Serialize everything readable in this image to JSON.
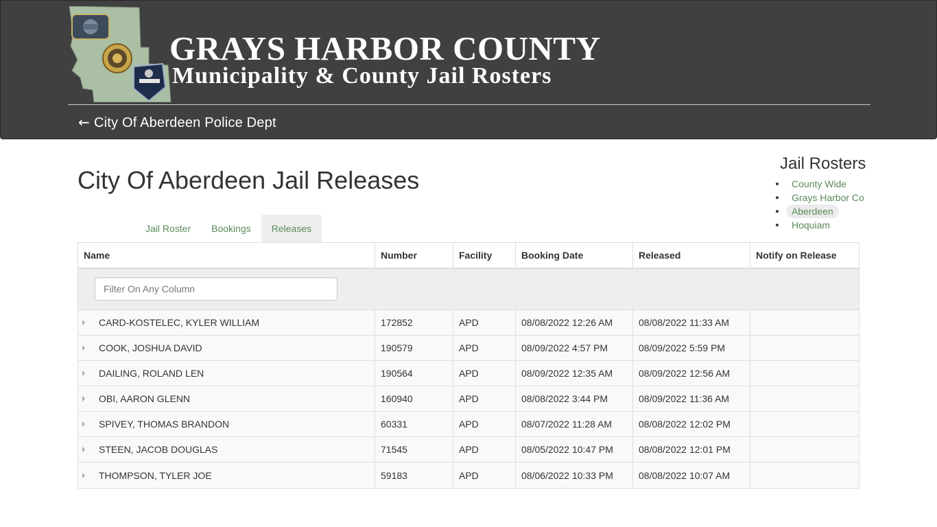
{
  "header": {
    "title": "GRAYS HARBOR COUNTY",
    "subtitle": "Municipality & County Jail Rosters",
    "back_arrow": "←",
    "back_label": "City Of Aberdeen Police Dept"
  },
  "page": {
    "title": "City Of Aberdeen Jail Releases"
  },
  "side_nav": {
    "heading": "Jail Rosters",
    "items": [
      {
        "label": "County Wide"
      },
      {
        "label": "Grays Harbor Co"
      },
      {
        "label": "Aberdeen"
      },
      {
        "label": "Hoquiam"
      }
    ]
  },
  "tabs": [
    {
      "label": "Jail Roster"
    },
    {
      "label": "Bookings"
    },
    {
      "label": "Releases"
    }
  ],
  "table": {
    "columns": [
      "Name",
      "Number",
      "Facility",
      "Booking Date",
      "Released",
      "Notify on Release"
    ],
    "filter_placeholder": "Filter On Any Column",
    "rows": [
      {
        "name": "CARD-KOSTELEC, KYLER WILLIAM",
        "number": "172852",
        "facility": "APD",
        "booking": "08/08/2022 12:26 AM",
        "released": "08/08/2022 11:33 AM",
        "notify": ""
      },
      {
        "name": "COOK, JOSHUA DAVID",
        "number": "190579",
        "facility": "APD",
        "booking": "08/09/2022 4:57 PM",
        "released": "08/09/2022 5:59 PM",
        "notify": ""
      },
      {
        "name": "DAILING, ROLAND LEN",
        "number": "190564",
        "facility": "APD",
        "booking": "08/09/2022 12:35 AM",
        "released": "08/09/2022 12:56 AM",
        "notify": ""
      },
      {
        "name": "OBI, AARON GLENN",
        "number": "160940",
        "facility": "APD",
        "booking": "08/08/2022 3:44 PM",
        "released": "08/09/2022 11:36 AM",
        "notify": ""
      },
      {
        "name": "SPIVEY, THOMAS BRANDON",
        "number": "60331",
        "facility": "APD",
        "booking": "08/07/2022 11:28 AM",
        "released": "08/08/2022 12:02 PM",
        "notify": ""
      },
      {
        "name": "STEEN, JACOB DOUGLAS",
        "number": "71545",
        "facility": "APD",
        "booking": "08/05/2022 10:47 PM",
        "released": "08/08/2022 12:01 PM",
        "notify": ""
      },
      {
        "name": "THOMPSON, TYLER JOE",
        "number": "59183",
        "facility": "APD",
        "booking": "08/06/2022 10:33 PM",
        "released": "08/08/2022 10:07 AM",
        "notify": ""
      }
    ]
  },
  "colors": {
    "header_bg": "#404040",
    "link_green": "#5a8a5a",
    "tab_active_bg": "#eeeeee"
  }
}
